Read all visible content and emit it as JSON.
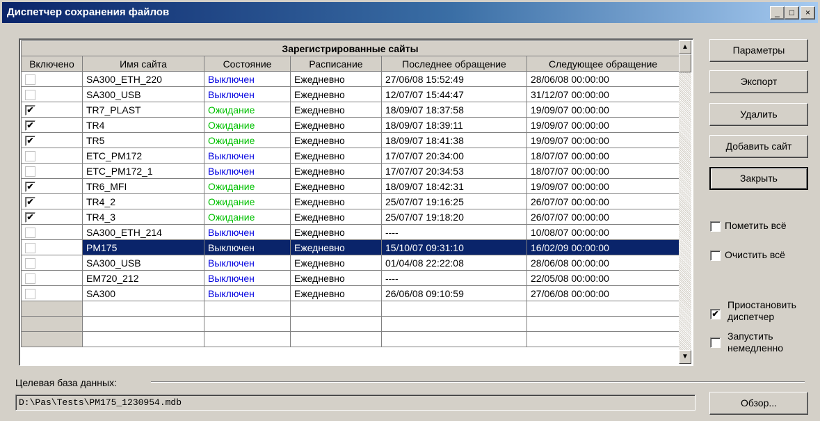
{
  "window": {
    "title": "Диспетчер сохранения файлов",
    "minimize": "_",
    "maximize": "□",
    "close": "×"
  },
  "grid": {
    "caption": "Зарегистрированные сайты",
    "columns": [
      "Включено",
      "Имя сайта",
      "Состояние",
      "Расписание",
      "Последнее обращение",
      "Следующее обращение"
    ],
    "rows": [
      {
        "enabled": false,
        "name": "SA300_ETH_220",
        "state": "Выключен",
        "state_kind": "off",
        "schedule": "Ежедневно",
        "last": "27/06/08 15:52:49",
        "next": "28/06/08 00:00:00"
      },
      {
        "enabled": false,
        "name": "SA300_USB",
        "state": "Выключен",
        "state_kind": "off",
        "schedule": "Ежедневно",
        "last": "12/07/07 15:44:47",
        "next": "31/12/07 00:00:00"
      },
      {
        "enabled": true,
        "name": "TR7_PLAST",
        "state": "Ожидание",
        "state_kind": "wait",
        "schedule": "Ежедневно",
        "last": "18/09/07 18:37:58",
        "next": "19/09/07 00:00:00"
      },
      {
        "enabled": true,
        "name": "TR4",
        "state": "Ожидание",
        "state_kind": "wait",
        "schedule": "Ежедневно",
        "last": "18/09/07 18:39:11",
        "next": "19/09/07 00:00:00"
      },
      {
        "enabled": true,
        "name": "TR5",
        "state": "Ожидание",
        "state_kind": "wait",
        "schedule": "Ежедневно",
        "last": "18/09/07 18:41:38",
        "next": "19/09/07 00:00:00"
      },
      {
        "enabled": false,
        "name": "ETC_PM172",
        "state": "Выключен",
        "state_kind": "off",
        "schedule": "Ежедневно",
        "last": "17/07/07 20:34:00",
        "next": "18/07/07 00:00:00"
      },
      {
        "enabled": false,
        "name": "ETC_PM172_1",
        "state": "Выключен",
        "state_kind": "off",
        "schedule": "Ежедневно",
        "last": "17/07/07 20:34:53",
        "next": "18/07/07 00:00:00"
      },
      {
        "enabled": true,
        "name": "TR6_MFI",
        "state": "Ожидание",
        "state_kind": "wait",
        "schedule": "Ежедневно",
        "last": "18/09/07 18:42:31",
        "next": "19/09/07 00:00:00"
      },
      {
        "enabled": true,
        "name": "TR4_2",
        "state": "Ожидание",
        "state_kind": "wait",
        "schedule": "Ежедневно",
        "last": "25/07/07 19:16:25",
        "next": "26/07/07 00:00:00"
      },
      {
        "enabled": true,
        "name": "TR4_3",
        "state": "Ожидание",
        "state_kind": "wait",
        "schedule": "Ежедневно",
        "last": "25/07/07 19:18:20",
        "next": "26/07/07 00:00:00"
      },
      {
        "enabled": false,
        "name": "SA300_ETH_214",
        "state": "Выключен",
        "state_kind": "off",
        "schedule": "Ежедневно",
        "last": "----",
        "next": "10/08/07 00:00:00"
      },
      {
        "enabled": false,
        "name": "PM175",
        "state": "Выключен",
        "state_kind": "off",
        "schedule": "Ежедневно",
        "last": "15/10/07 09:31:10",
        "next": "16/02/09 00:00:00",
        "selected": true
      },
      {
        "enabled": false,
        "name": "SA300_USB",
        "state": "Выключен",
        "state_kind": "off",
        "schedule": "Ежедневно",
        "last": "01/04/08 22:22:08",
        "next": "28/06/08 00:00:00"
      },
      {
        "enabled": false,
        "name": "EM720_212",
        "state": "Выключен",
        "state_kind": "off",
        "schedule": "Ежедневно",
        "last": "----",
        "next": "22/05/08 00:00:00"
      },
      {
        "enabled": false,
        "name": "SA300",
        "state": "Выключен",
        "state_kind": "off",
        "schedule": "Ежедневно",
        "last": "26/06/08 09:10:59",
        "next": "27/06/08 00:00:00"
      }
    ],
    "empty_rows": 3,
    "colors": {
      "state_off": "#0000e0",
      "state_wait": "#00c000",
      "selection": "#0a246a"
    }
  },
  "buttons": {
    "params": "Параметры",
    "export": "Экспорт",
    "delete": "Удалить",
    "add_site": "Добавить сайт",
    "close": "Закрыть",
    "browse": "Обзор..."
  },
  "options": {
    "mark_all": {
      "label": "Пометить всё",
      "checked": false
    },
    "clear_all": {
      "label": "Очистить всё",
      "checked": false
    },
    "pause_line1": "Приостановить",
    "pause_line2": "диспетчер",
    "pause_checked": true,
    "start_line1": "Запустить",
    "start_line2": "немедленно",
    "start_checked": false
  },
  "database": {
    "label": "Целевая база данных:",
    "path": "D:\\Pas\\Tests\\PM175_1230954.mdb"
  }
}
